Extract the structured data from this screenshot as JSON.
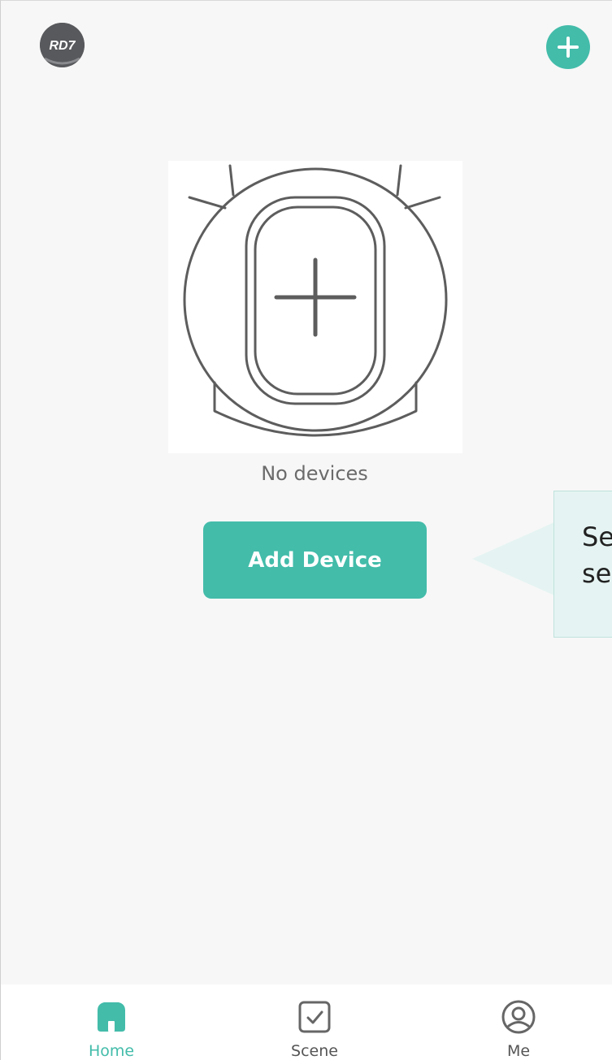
{
  "header": {
    "brand_logo_text": "RD7",
    "avatar_icon": "brand-logo-icon",
    "add_icon": "plus-circle-icon"
  },
  "empty_state": {
    "illustration_icon": "robot-vacuum-add-icon",
    "message": "No devices",
    "button_label": "Add Device"
  },
  "callout": {
    "line1": "Se",
    "line2": "se"
  },
  "tabbar": {
    "items": [
      {
        "label": "Home",
        "icon": "home-icon",
        "active": true
      },
      {
        "label": "Scene",
        "icon": "checkbox-icon",
        "active": false
      },
      {
        "label": "Me",
        "icon": "user-icon",
        "active": false
      }
    ]
  },
  "colors": {
    "accent": "#43bcaa",
    "background": "#f7f7f7",
    "callout_bg": "#e5f4f2",
    "inactive_text": "#555555",
    "muted_text": "#6b6b6b"
  }
}
